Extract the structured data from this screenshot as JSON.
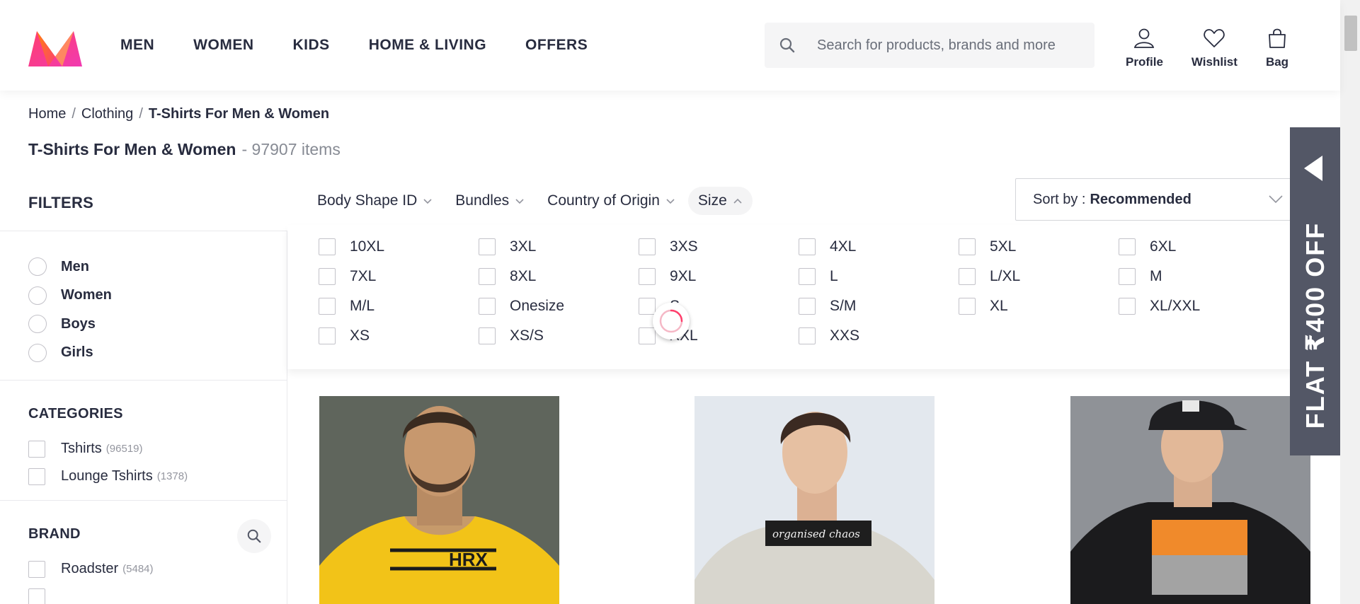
{
  "header": {
    "nav": [
      "MEN",
      "WOMEN",
      "KIDS",
      "HOME & LIVING",
      "OFFERS"
    ],
    "search_placeholder": "Search for products, brands and more",
    "actions": [
      "Profile",
      "Wishlist",
      "Bag"
    ]
  },
  "breadcrumb": {
    "home": "Home",
    "clothing": "Clothing",
    "current": "T-Shirts For Men & Women"
  },
  "page": {
    "title": "T-Shirts For Men & Women",
    "count": "- 97907 items"
  },
  "filters": {
    "heading": "FILTERS",
    "gender": [
      "Men",
      "Women",
      "Boys",
      "Girls"
    ],
    "categories": {
      "heading": "CATEGORIES",
      "items": [
        {
          "label": "Tshirts",
          "count": "(96519)"
        },
        {
          "label": "Lounge Tshirts",
          "count": "(1378)"
        }
      ]
    },
    "brand": {
      "heading": "BRAND",
      "items": [
        {
          "label": "Roadster",
          "count": "(5484)"
        }
      ]
    }
  },
  "hfilters": [
    "Body Shape ID",
    "Bundles",
    "Country of Origin",
    "Size"
  ],
  "sort": {
    "label": "Sort by :",
    "value": "Recommended"
  },
  "sizes": [
    "10XL",
    "3XL",
    "3XS",
    "4XL",
    "5XL",
    "6XL",
    "7XL",
    "8XL",
    "9XL",
    "L",
    "L/XL",
    "M",
    "M/L",
    "Onesize",
    "S",
    "S/M",
    "XL",
    "XL/XXL",
    "XS",
    "XS/S",
    "XXL",
    "XXS"
  ],
  "offer": "FLAT ₹400 OFF",
  "products": [
    {
      "print_text": "HRX",
      "shirt_color": "#f2c318"
    },
    {
      "print_text": "organised chaos",
      "shirt_color": "#d8d6ce"
    },
    {
      "print_text": "",
      "shirt_color": "#1b1b1d"
    }
  ],
  "colors": {
    "accent": "#ff3f6c",
    "text": "#282c3f",
    "offer_bg": "#535766"
  }
}
